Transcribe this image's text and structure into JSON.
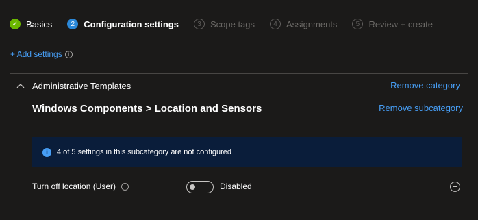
{
  "wizard": {
    "steps": [
      {
        "number": "✓",
        "label": "Basics",
        "state": "done"
      },
      {
        "number": "2",
        "label": "Configuration settings",
        "state": "current"
      },
      {
        "number": "3",
        "label": "Scope tags",
        "state": "pending"
      },
      {
        "number": "4",
        "label": "Assignments",
        "state": "pending"
      },
      {
        "number": "5",
        "label": "Review + create",
        "state": "pending"
      }
    ]
  },
  "add_settings": {
    "label": "+ Add settings",
    "info_glyph": "i"
  },
  "category": {
    "title": "Administrative Templates",
    "remove_label": "Remove category",
    "subcategory": {
      "title": "Windows Components > Location and Sensors",
      "remove_label": "Remove subcategory",
      "banner": {
        "icon_glyph": "i",
        "text": "4 of 5 settings in this subcategory are not configured"
      },
      "settings": [
        {
          "label": "Turn off location (User)",
          "info_glyph": "i",
          "value_label": "Disabled",
          "enabled": false
        }
      ]
    }
  },
  "colors": {
    "background": "#1b1a19",
    "accent": "#479ef5",
    "step_done": "#6bb700",
    "step_current": "#2b88d8",
    "banner_bg": "#0a1d3a"
  }
}
